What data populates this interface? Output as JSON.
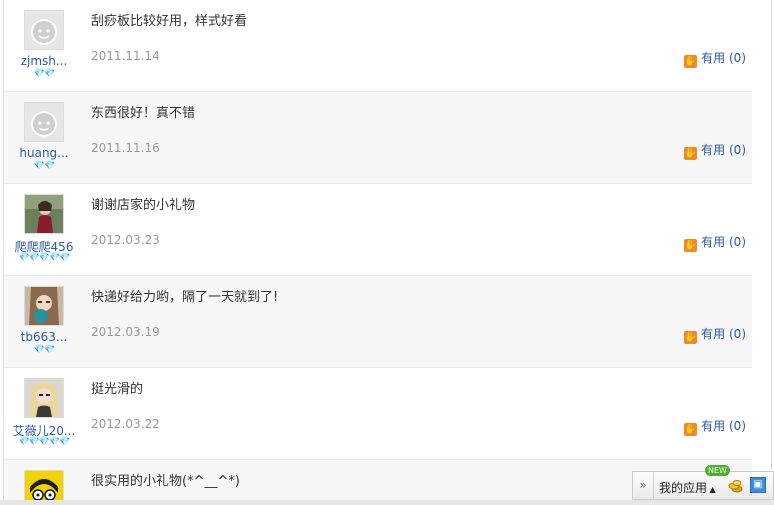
{
  "useful_label": "有用",
  "reviews": [
    {
      "user": "zjmsh...",
      "gems": "💎💎",
      "comment": "刮痧板比较好用，样式好看",
      "date": "2011.11.14",
      "useful_count": "(0)"
    },
    {
      "user": "huang...",
      "gems": "💎💎",
      "comment": "东西很好！真不错",
      "date": "2011.11.16",
      "useful_count": "(0)"
    },
    {
      "user": "爬爬爬456",
      "gems": "💎💎💎💎💎",
      "comment": "谢谢店家的小礼物",
      "date": "2012.03.23",
      "useful_count": "(0)"
    },
    {
      "user": "tb663...",
      "gems": "💎💎",
      "comment": "快递好给力哟，隔了一天就到了!",
      "date": "2012.03.19",
      "useful_count": "(0)"
    },
    {
      "user": "艾薇儿20...",
      "gems": "💎💎💎💎💎",
      "comment": "挺光滑的",
      "date": "2012.03.22",
      "useful_count": "(0)"
    },
    {
      "comment": "很实用的小礼物(*^__^*)"
    }
  ],
  "appbar": {
    "my_apps": "我的应用",
    "new_badge": "NEW"
  }
}
